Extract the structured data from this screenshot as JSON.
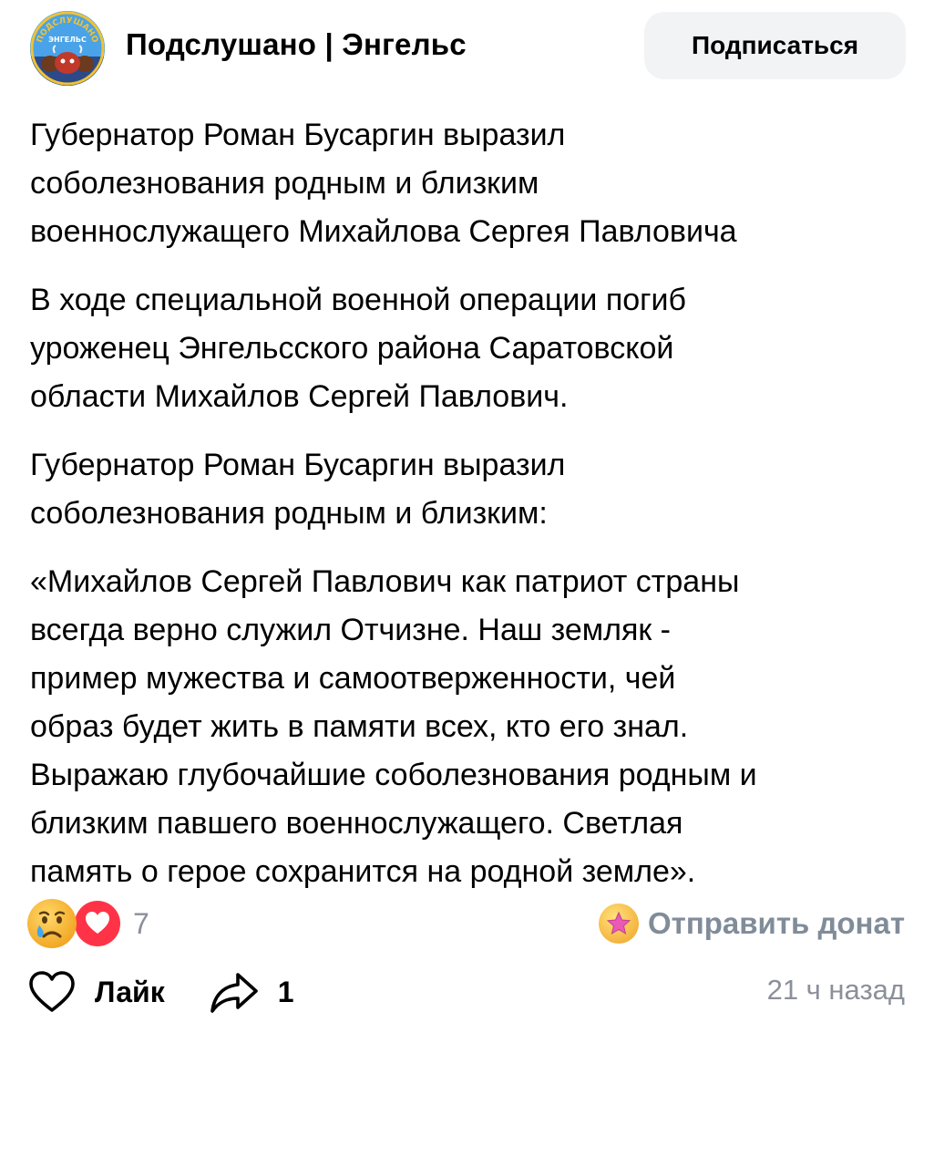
{
  "header": {
    "group_name": "Подслушано | Энгельс",
    "subscribe_label": "Подписаться",
    "avatar_text_top": "ПОДСЛУШАНО",
    "avatar_text_bottom": "ЭНГЕЛЬС"
  },
  "post": {
    "paragraphs": [
      "Губернатор Роман Бусаргин выразил\nсоболезнования родным и близким\nвоеннослужащего Михайлова Сергея Павловича",
      "В ходе специальной военной операции погиб\nуроженец Энгельсского района Саратовской\nобласти Михайлов Сергей Павлович.",
      "Губернатор Роман Бусаргин выразил\nсоболезнования родным и близким:",
      "«Михайлов Сергей Павлович как патриот страны\nвсегда верно служил Отчизне. Наш земляк -\nпример мужества и самоотверженности, чей\nобраз будет жить в памяти всех, кто его знал.\nВыражаю глубочайшие соболезнования родным и\nблизким павшего военнослужащего. Светлая\nпамять о герое сохранится на родной земле»."
    ]
  },
  "reactions": {
    "icons": [
      "crying-face-icon",
      "heart-icon"
    ],
    "count": "7"
  },
  "donate": {
    "label": "Отправить донат",
    "icon": "star-icon"
  },
  "actions": {
    "like_label": "Лайк",
    "share_count": "1"
  },
  "timestamp": "21 ч назад",
  "colors": {
    "secondary_text": "#818c99",
    "button_bg": "#f2f3f5",
    "heart_red": "#ff3347"
  }
}
